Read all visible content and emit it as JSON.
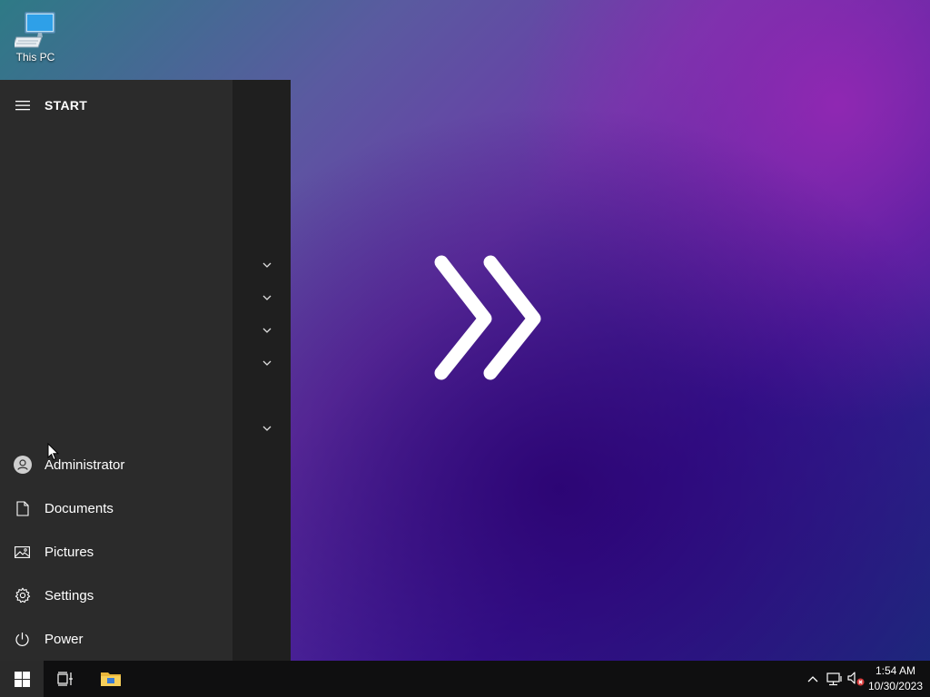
{
  "desktop": {
    "icons": [
      {
        "label": "This PC",
        "icon": "computer-icon"
      }
    ]
  },
  "start_menu": {
    "title": "START",
    "items": [
      {
        "label": "Administrator",
        "icon": "user-avatar-icon"
      },
      {
        "label": "Documents",
        "icon": "document-icon"
      },
      {
        "label": "Pictures",
        "icon": "pictures-icon"
      },
      {
        "label": "Settings",
        "icon": "gear-icon"
      },
      {
        "label": "Power",
        "icon": "power-icon"
      }
    ]
  },
  "taskbar": {
    "time": "1:54 AM",
    "date": "10/30/2023"
  },
  "colors": {
    "start_bg": "#2b2b2b",
    "start_rail": "#1f1f1f",
    "taskbar_bg": "#0f0f10"
  }
}
